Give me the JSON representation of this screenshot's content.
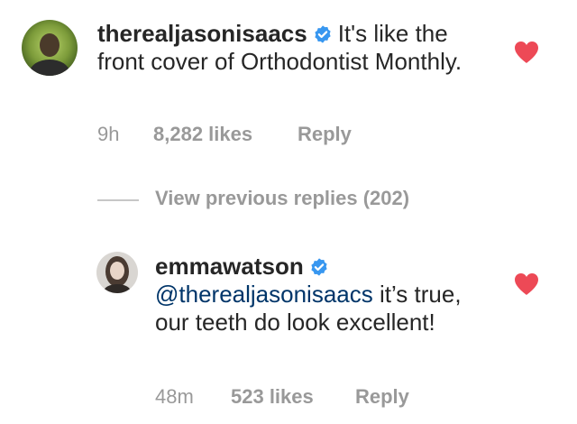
{
  "colors": {
    "text": "#262626",
    "meta": "#999999",
    "mention": "#003569",
    "verified": "#3897f0",
    "heart": "#ed4956"
  },
  "comments": [
    {
      "avatar_icon": "user-avatar-jason",
      "username": "therealjasonisaacs",
      "verified": true,
      "mention": "",
      "text": "It's like the front cover of Orthodontist Monthly.",
      "time": "9h",
      "likes": "8,282 likes",
      "reply_label": "Reply",
      "liked": true
    },
    {
      "avatar_icon": "user-avatar-emma",
      "username": "emmawatson",
      "verified": true,
      "mention": "@therealjasonisaacs",
      "text": "it’s true, our teeth do look excellent!",
      "time": "48m",
      "likes": "523 likes",
      "reply_label": "Reply",
      "liked": true
    }
  ],
  "view_previous_replies": "View previous replies (202)"
}
